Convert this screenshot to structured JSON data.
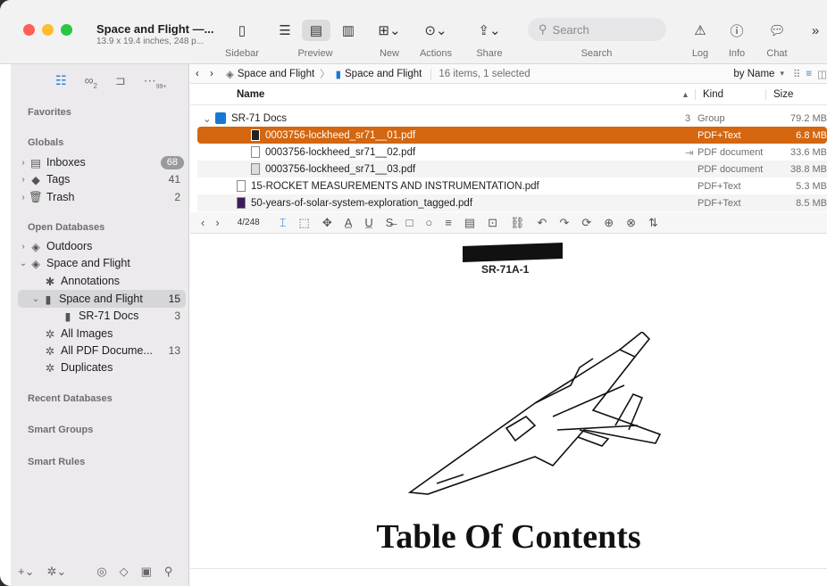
{
  "window": {
    "title": "Space and Flight —...",
    "subtitle": "13.9 x 19.4 inches, 248 p...",
    "traffic_colors": [
      "#fe5f57",
      "#febc2e",
      "#28c840"
    ]
  },
  "toolbar": {
    "sidebar_label": "Sidebar",
    "preview_label": "Preview",
    "new_label": "New",
    "actions_label": "Actions",
    "share_label": "Share",
    "search_label": "Search",
    "search_placeholder": "Search",
    "log_label": "Log",
    "info_label": "Info",
    "chat_label": "Chat"
  },
  "sidebar": {
    "favorites": "Favorites",
    "globals": "Globals",
    "inboxes": "Inboxes",
    "inboxes_count": "68",
    "tags": "Tags",
    "tags_count": "41",
    "trash": "Trash",
    "trash_count": "2",
    "open_databases": "Open Databases",
    "outdoors": "Outdoors",
    "space_and_flight_db": "Space and Flight",
    "annotations": "Annotations",
    "space_and_flight_group": "Space and Flight",
    "space_and_flight_count": "15",
    "sr71_docs": "SR-71 Docs",
    "sr71_docs_count": "3",
    "all_images": "All Images",
    "all_pdf": "All PDF Docume...",
    "all_pdf_count": "13",
    "duplicates": "Duplicates",
    "recent_databases": "Recent Databases",
    "smart_groups": "Smart Groups",
    "smart_rules": "Smart Rules",
    "tab_badge_2": "2",
    "tab_badge_99": "99+"
  },
  "pathbar": {
    "crumb1": "Space and Flight",
    "crumb2": "Space and Flight",
    "status": "16 items, 1 selected",
    "sort": "by Name"
  },
  "list": {
    "col_name": "Name",
    "col_kind": "Kind",
    "col_size": "Size",
    "rows": [
      {
        "name": "SR-71 Docs",
        "count": "3",
        "kind": "Group",
        "size": "79.2 MB"
      },
      {
        "name": "0003756-lockheed_sr71__01.pdf",
        "kind": "PDF+Text",
        "size": "6.8 MB"
      },
      {
        "name": "0003756-lockheed_sr71__02.pdf",
        "kind": "PDF document",
        "size": "33.6 MB"
      },
      {
        "name": "0003756-lockheed_sr71__03.pdf",
        "kind": "PDF document",
        "size": "38.8 MB"
      },
      {
        "name": "15-ROCKET MEASUREMENTS AND INSTRUMENTATION.pdf",
        "kind": "PDF+Text",
        "size": "5.3 MB"
      },
      {
        "name": "50-years-of-solar-system-exploration_tagged.pdf",
        "kind": "PDF+Text",
        "size": "8.5 MB"
      }
    ]
  },
  "pdf": {
    "page": "4/248",
    "caption": "SR-71A-1",
    "heading": "Table Of Contents"
  },
  "colors": {
    "selection": "#d4660f",
    "accent": "#1778d4"
  }
}
